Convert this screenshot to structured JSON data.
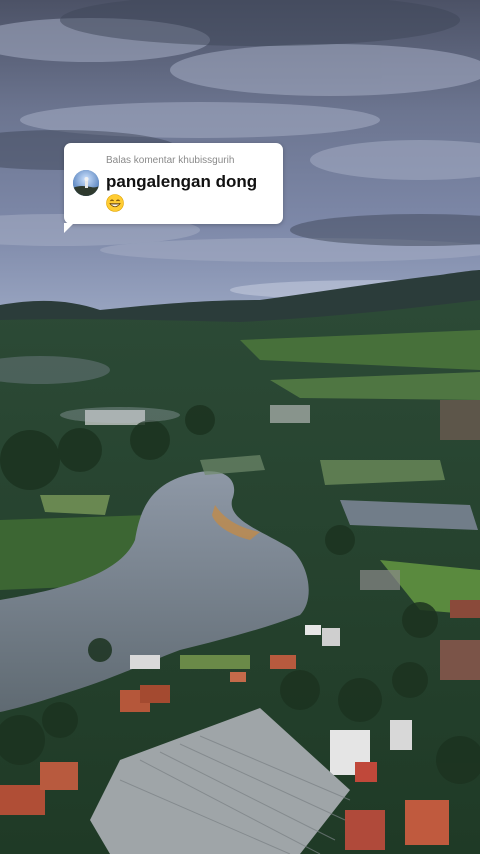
{
  "reply": {
    "header": "Balas komentar khubissgurih",
    "comment": "pangalengan dong",
    "emoji_icon": "grinning-face-emoji"
  },
  "scene": {
    "description_icon": "aerial-lake-village-photo"
  },
  "colors": {
    "bubble_bg": "#ffffff",
    "header_text": "#8a8a8a",
    "comment_text": "#111111"
  }
}
